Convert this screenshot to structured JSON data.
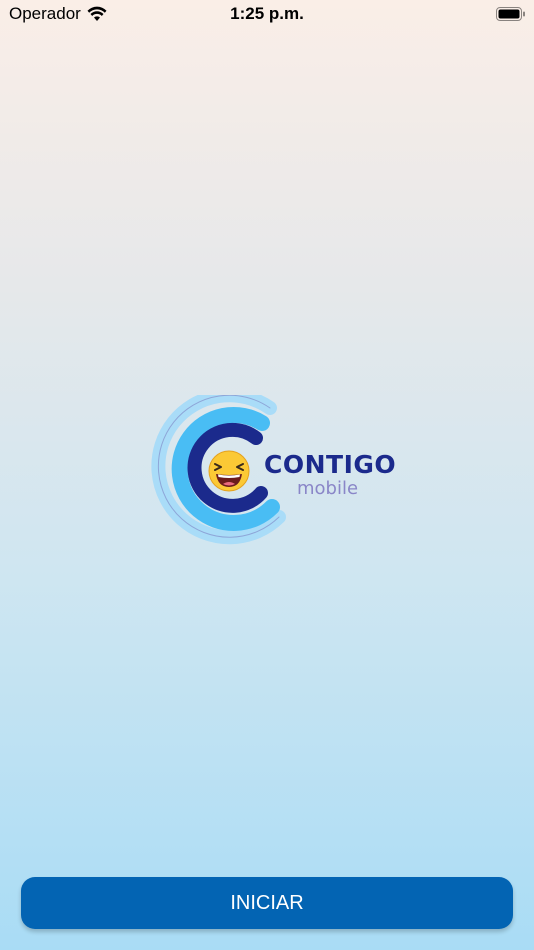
{
  "status_bar": {
    "carrier": "Operador",
    "time": "1:25 p.m."
  },
  "logo": {
    "brand": "CONTIGO",
    "sub": "mobile"
  },
  "actions": {
    "start_label": "INICIAR"
  },
  "colors": {
    "primary": "#0364b3",
    "brand_text": "#1b2a8c",
    "sub_text": "#8a86c8"
  }
}
